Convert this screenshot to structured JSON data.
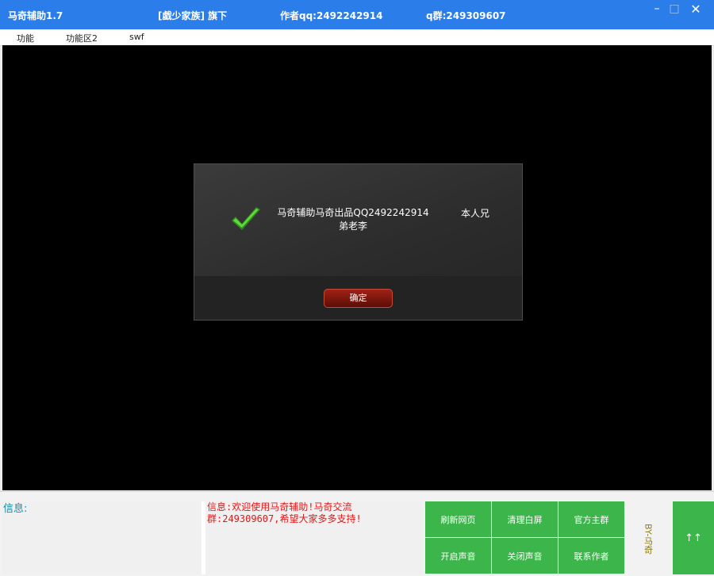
{
  "window": {
    "title": "马奇辅助1.7",
    "clan": "[戯少家族] 旗下",
    "author": "作者qq:2492242914",
    "group": "q群:249309607"
  },
  "menu": [
    "功能",
    "功能区2",
    "swf"
  ],
  "dialog": {
    "message": "马奇辅助马奇出品QQ2492242914 弟老李",
    "side_text": "本人兄",
    "ok_label": "确定"
  },
  "bottom": {
    "info_label": "信息:",
    "message": "信息:欢迎使用马奇辅助!马奇交流群:249309607,希望大家多多支持!",
    "buttons": [
      "刷新网页",
      "清理白屏",
      "官方主群",
      "开启声音",
      "关闭声音",
      "联系作者"
    ],
    "by_text": "BY-马奇",
    "up_label": "↑↑"
  },
  "colors": {
    "titlebar": "#2b7de9",
    "green_button": "#3cb54a",
    "message_text": "#e31818",
    "info_label": "#1d8aa8"
  }
}
